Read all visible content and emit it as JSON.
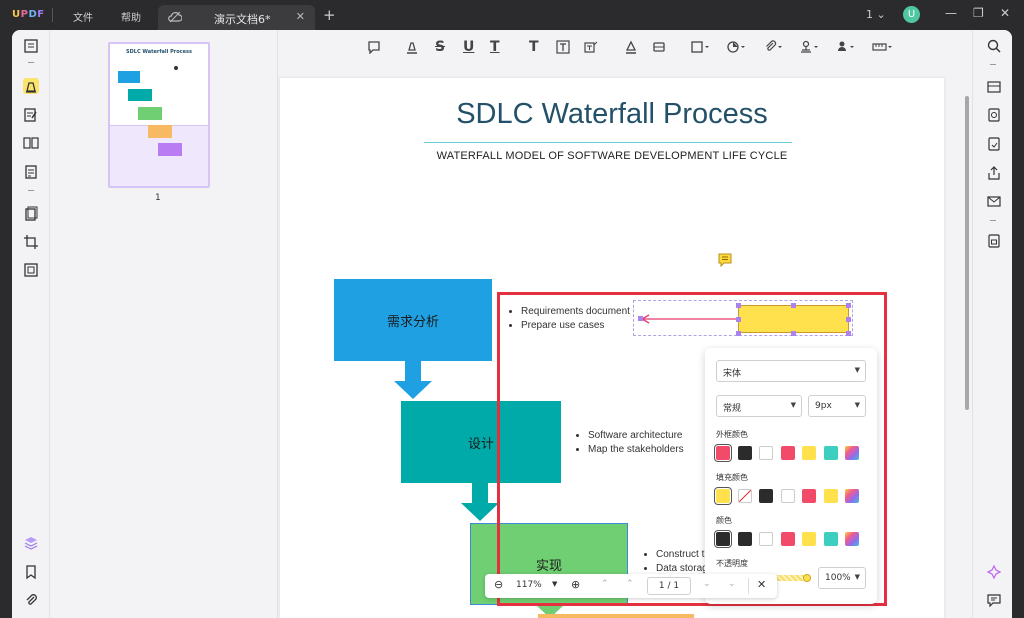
{
  "app": {
    "logo": "UPDF",
    "menu": [
      "文件",
      "帮助"
    ],
    "tab_title": "演示文档6*",
    "page_indicator": "1",
    "avatar_letter": "U"
  },
  "thumbnail": {
    "page_number": "1",
    "mini_title": "SDLC Waterfall Process"
  },
  "document": {
    "title": "SDLC Waterfall Process",
    "subtitle": "WATERFALL MODEL OF SOFTWARE DEVELOPMENT LIFE CYCLE",
    "steps": [
      {
        "label": "需求分析",
        "color": "#1ea0e2",
        "bullets": [
          "Requirements document",
          "Prepare use cases"
        ]
      },
      {
        "label": "设计",
        "color": "#00aaa9",
        "bullets": [
          "Software architecture",
          "Map the stakeholders"
        ]
      },
      {
        "label": "实现",
        "color": "#6fcf72",
        "bullets": [
          "Construct t",
          "Data storag"
        ]
      }
    ],
    "arrow_color": "#1ea0e2"
  },
  "properties": {
    "font": "宋体",
    "style": "常规",
    "size": "9px",
    "border_color_label": "外框颜色",
    "fill_color_label": "填充颜色",
    "color_label": "颜色",
    "opacity_label": "不透明度",
    "opacity_value": "100%",
    "border_colors": [
      "#f24b6a",
      "#2b2b2b",
      "#ffffff",
      "#f24b6a",
      "#ffe14d",
      "#3ccfc0",
      "rainbow"
    ],
    "fill_colors": [
      "#ffe14d",
      "none",
      "#2b2b2b",
      "#ffffff",
      "#f24b6a",
      "#ffe14d",
      "rainbow"
    ],
    "text_colors": [
      "#2b2b2b",
      "#2b2b2b",
      "#ffffff",
      "#f24b6a",
      "#ffe14d",
      "#3ccfc0",
      "rainbow"
    ]
  },
  "zoom": {
    "value": "117%",
    "current_page": "1",
    "separator": "/",
    "total_pages": "1"
  }
}
